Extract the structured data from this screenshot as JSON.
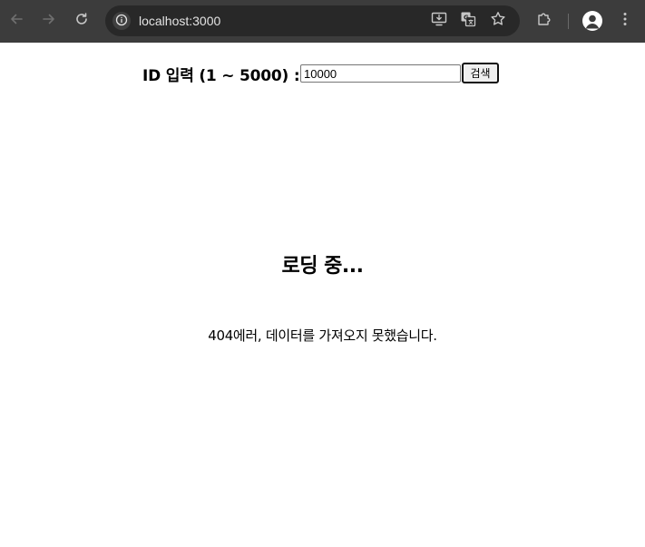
{
  "browser": {
    "url": "localhost:3000",
    "icons": {
      "back": "arrow-left-icon",
      "forward": "arrow-right-icon",
      "reload": "reload-icon",
      "site_info": "info-icon",
      "install": "install-app-icon",
      "translate": "translate-icon",
      "bookmark": "star-icon",
      "extensions": "puzzle-icon",
      "profile": "avatar-icon",
      "menu": "kebab-menu-icon"
    },
    "colors": {
      "toolbar_bg": "#3c3c3c",
      "omnibox_bg": "#282828",
      "icon_color": "#c7c7c7",
      "url_color": "#e3e3e3"
    }
  },
  "search": {
    "label": "ID 입력 (1 ~ 5000) :",
    "input_value": "10000",
    "button_label": "검색"
  },
  "status": {
    "loading": "로딩 중...",
    "error": "404에러, 데이터를 가져오지 못했습니다."
  }
}
